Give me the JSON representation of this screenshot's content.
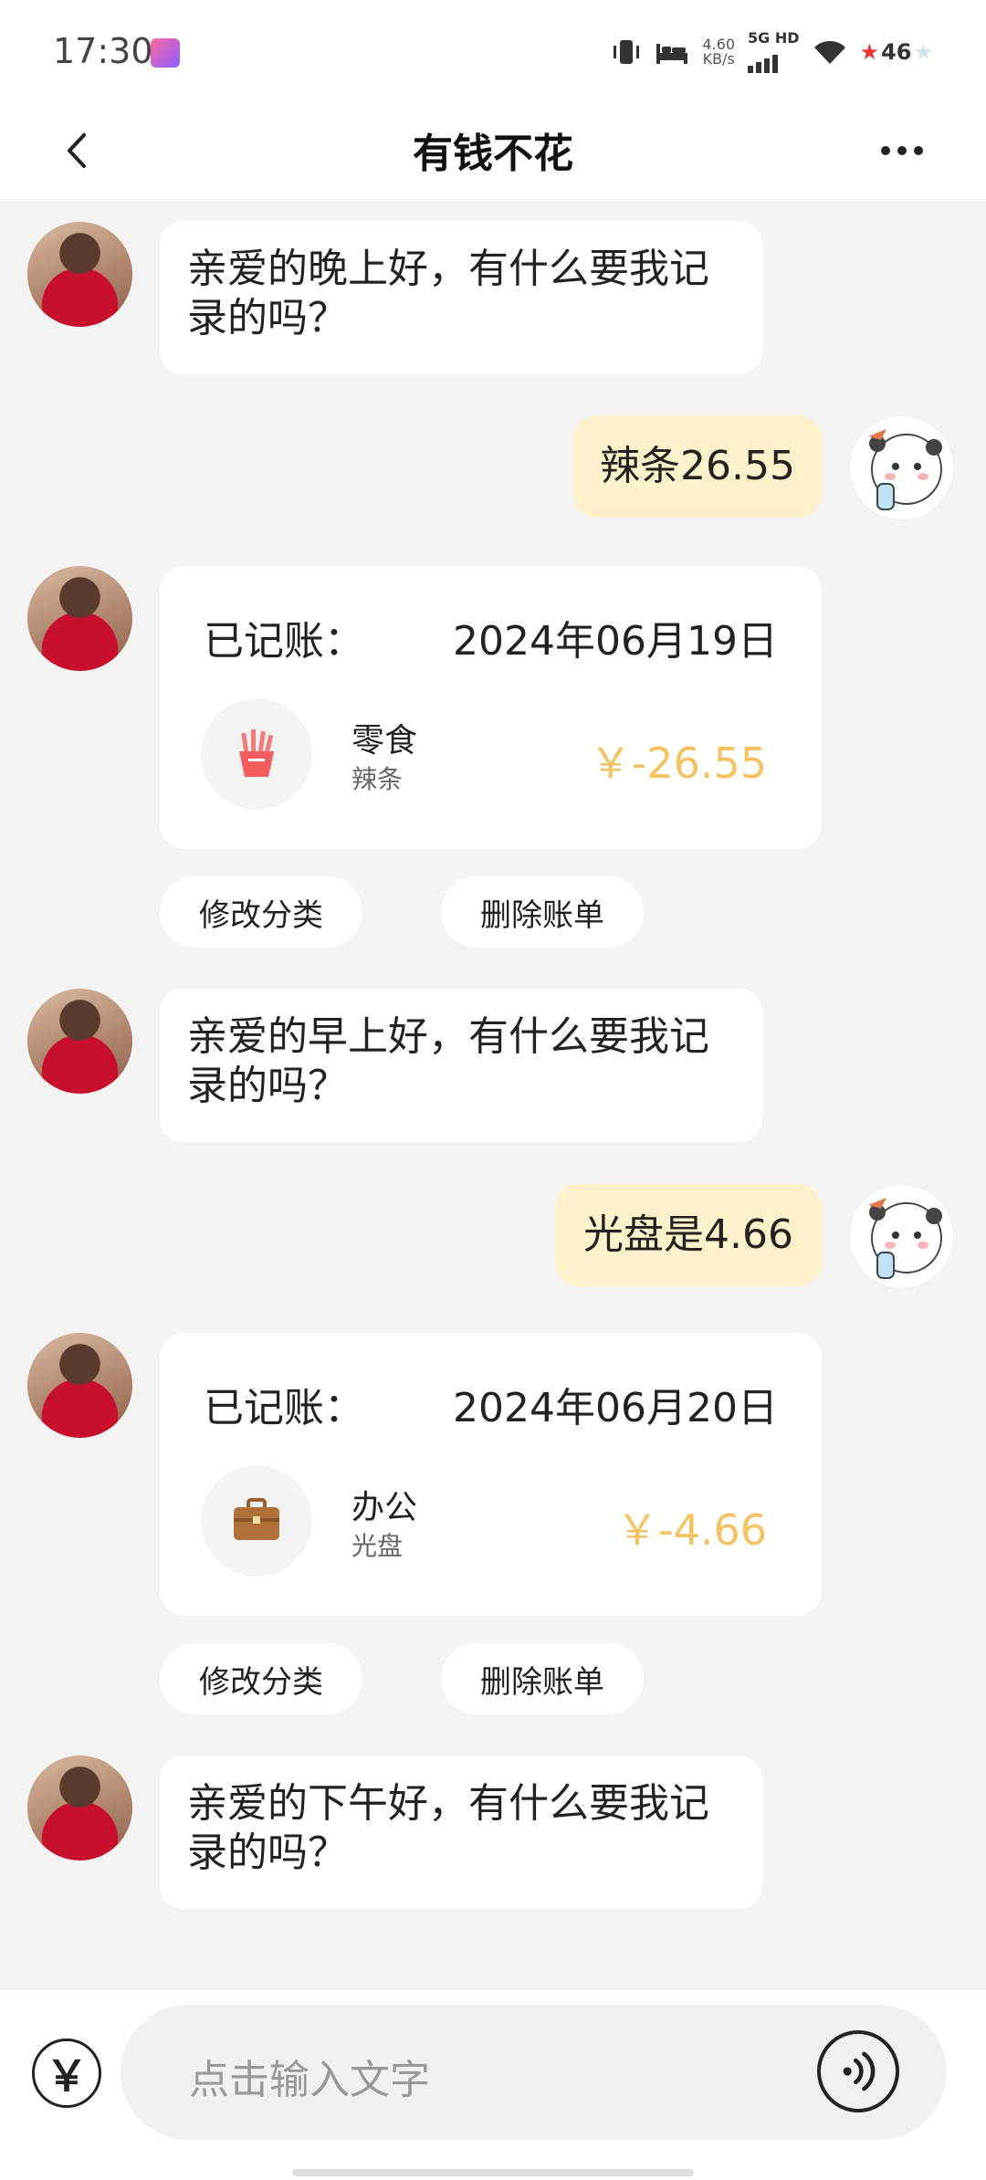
{
  "status": {
    "time": "17:30",
    "speed_value": "4.60",
    "speed_unit": "KB/s",
    "network": "5G HD",
    "battery": "46"
  },
  "header": {
    "title": "有钱不花"
  },
  "messages": {
    "greet_evening": "亲爱的晚上好，有什么要我记录的吗？",
    "user_msg_1": "辣条26.55",
    "greet_morning": "亲爱的早上好，有什么要我记录的吗？",
    "user_msg_2": "光盘是4.66",
    "greet_afternoon": "亲爱的下午好，有什么要我记录的吗？"
  },
  "records": [
    {
      "label": "已记账：",
      "date": "2024年06月19日",
      "category": "零食",
      "note": "辣条",
      "amount": "￥-26.55",
      "icon": "fries-icon"
    },
    {
      "label": "已记账：",
      "date": "2024年06月20日",
      "category": "办公",
      "note": "光盘",
      "amount": "￥-4.66",
      "icon": "briefcase-icon"
    }
  ],
  "actions": {
    "edit_category": "修改分类",
    "delete_bill": "删除账单"
  },
  "input": {
    "placeholder": "点击输入文字",
    "currency_symbol": "￥"
  },
  "colors": {
    "amount": "#f5c261",
    "user_bubble": "#fdf1cc",
    "background": "#f3f3f3"
  }
}
